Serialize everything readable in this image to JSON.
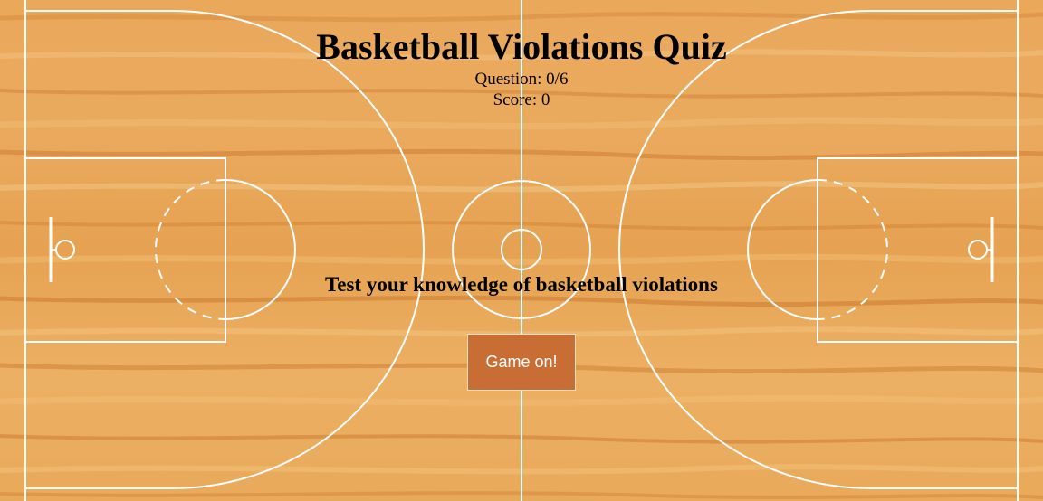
{
  "quiz": {
    "title": "Basketball Violations Quiz",
    "question_progress": "Question: 0/6",
    "score": "Score: 0",
    "subtitle": "Test your knowledge of basketball violations",
    "start_button_label": "Game on!"
  },
  "colors": {
    "court_wood": "#e8a555",
    "court_lines": "#ffffff",
    "button_bg": "#c86e34",
    "button_text": "#ffffff"
  }
}
